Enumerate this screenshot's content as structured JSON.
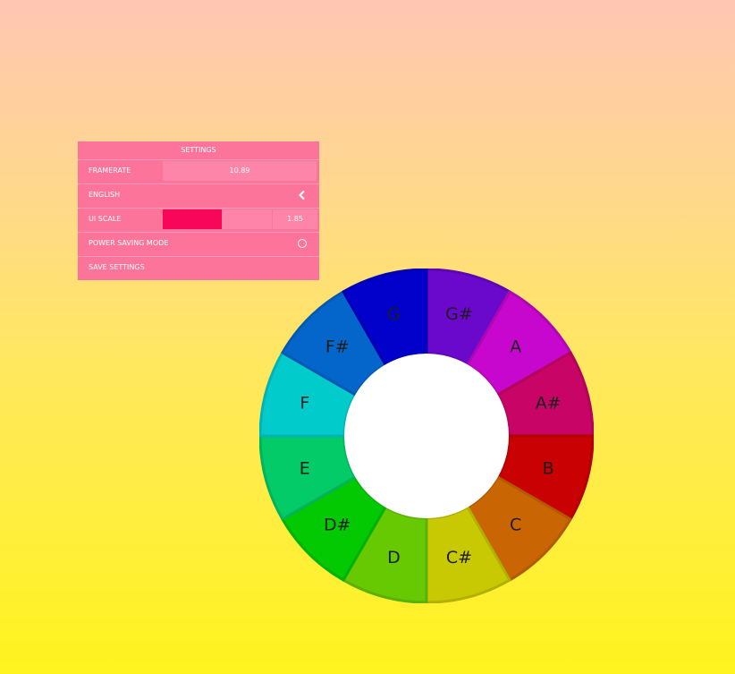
{
  "settings": {
    "title": "SETTINGS",
    "framerate_label": "FRAMERATE",
    "framerate_value": "10.89",
    "language_label": "ENGLISH",
    "ui_scale_label": "UI SCALE",
    "ui_scale_value": "1.85",
    "ui_scale_fill_fraction": 0.54,
    "power_saving_label": "POWER SAVING MODE",
    "power_saving_enabled": false,
    "save_label": "SAVE SETTINGS",
    "colors": {
      "panel": "#fc7499",
      "field": "#ff84aa",
      "slider_fill": "#f70659"
    }
  },
  "wheel": {
    "notes": [
      {
        "label": "G#",
        "color": "#6a08cc"
      },
      {
        "label": "A",
        "color": "#c707cd"
      },
      {
        "label": "A#",
        "color": "#c80467"
      },
      {
        "label": "B",
        "color": "#c90102"
      },
      {
        "label": "C",
        "color": "#c96603"
      },
      {
        "label": "C#",
        "color": "#c9c903"
      },
      {
        "label": "D",
        "color": "#67c902"
      },
      {
        "label": "D#",
        "color": "#02c902"
      },
      {
        "label": "E",
        "color": "#02cb67"
      },
      {
        "label": "F",
        "color": "#02cbcc"
      },
      {
        "label": "F#",
        "color": "#0466cb"
      },
      {
        "label": "G",
        "color": "#0101cb"
      }
    ],
    "center_color": "#ffffff"
  }
}
